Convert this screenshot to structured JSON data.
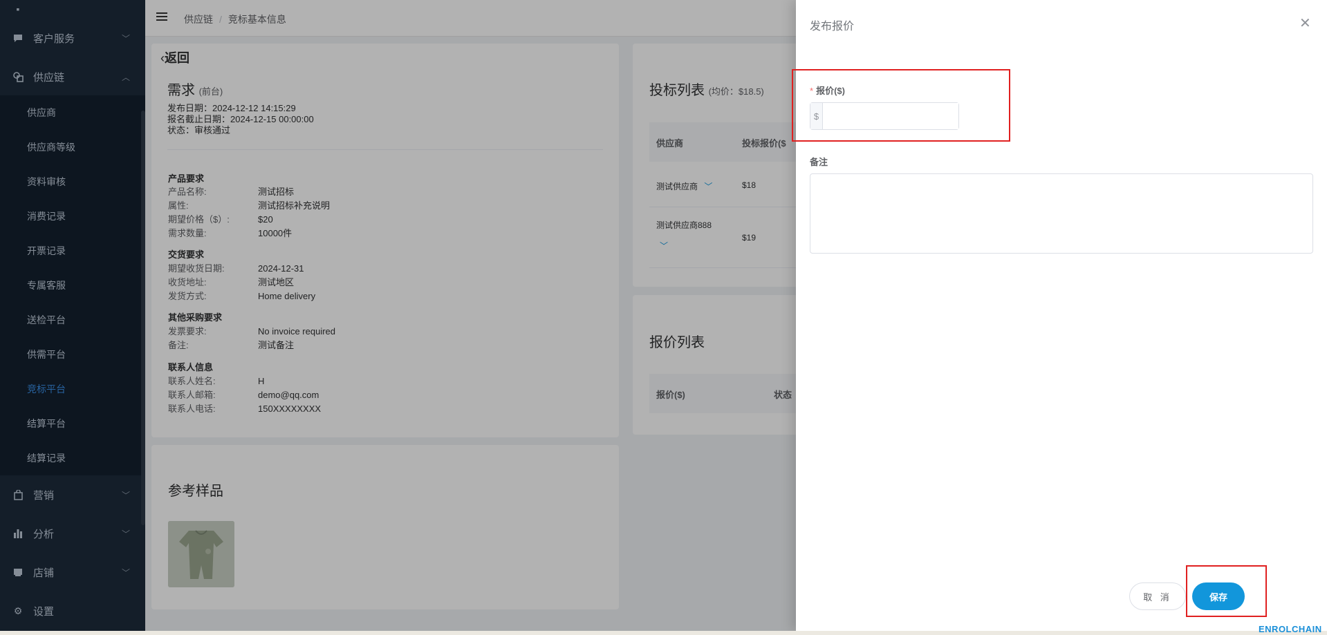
{
  "sidebar": {
    "menu": [
      {
        "label": "客户服务",
        "icon": "chat-icon"
      },
      {
        "label": "供应链",
        "icon": "supply-chain-icon"
      },
      {
        "label": "营销",
        "icon": "bag-icon"
      },
      {
        "label": "分析",
        "icon": "bar-chart-icon"
      },
      {
        "label": "店铺",
        "icon": "store-icon"
      },
      {
        "label": "设置",
        "icon": "gear-icon"
      }
    ],
    "submenu": [
      "供应商",
      "供应商等级",
      "资料审核",
      "消费记录",
      "开票记录",
      "专属客服",
      "送检平台",
      "供需平台",
      "竞标平台",
      "结算平台",
      "结算记录"
    ],
    "active_item": "竞标平台"
  },
  "header": {
    "breadcrumb": [
      "供应链",
      "竞标基本信息"
    ]
  },
  "detail": {
    "back_label": "返回",
    "title": "需求",
    "title_tag": "(前台)",
    "publish_date": "发布日期：2024-12-12 14:15:29",
    "deadline": "报名截止日期：2024-12-15 00:00:00",
    "status": "状态：审核通过",
    "sections": [
      {
        "title": "产品要求",
        "rows": [
          {
            "k": "产品名称:",
            "v": "测试招标"
          },
          {
            "k": "属性:",
            "v": "测试招标补充说明"
          },
          {
            "k": "期望价格（$）:",
            "v": "$20"
          },
          {
            "k": "需求数量:",
            "v": "10000件"
          }
        ]
      },
      {
        "title": "交货要求",
        "rows": [
          {
            "k": "期望收货日期:",
            "v": "2024-12-31"
          },
          {
            "k": "收货地址:",
            "v": "测试地区"
          },
          {
            "k": "发货方式:",
            "v": "Home delivery"
          }
        ]
      },
      {
        "title": "其他采购要求",
        "rows": [
          {
            "k": "发票要求:",
            "v": "No invoice required"
          },
          {
            "k": "备注:",
            "v": "测试备注"
          }
        ]
      },
      {
        "title": "联系人信息",
        "rows": [
          {
            "k": "联系人姓名:",
            "v": "H"
          },
          {
            "k": "联系人邮箱:",
            "v": "demo@qq.com"
          },
          {
            "k": "联系人电话:",
            "v": "150XXXXXXXX"
          }
        ]
      }
    ]
  },
  "samples": {
    "title": "参考样品"
  },
  "bids": {
    "title": "投标列表",
    "avg": "(均价：$18.5)",
    "columns": [
      "供应商",
      "投标报价($"
    ],
    "rows": [
      {
        "supplier": "测试供应商",
        "price": "$18"
      },
      {
        "supplier": "测试供应商888",
        "price": "$19"
      }
    ]
  },
  "quotes": {
    "title": "报价列表",
    "columns": [
      "报价($)",
      "状态"
    ]
  },
  "drawer": {
    "title": "发布报价",
    "price_label": "报价($)",
    "price_prefix": "$",
    "price_value": "",
    "note_label": "备注",
    "note_value": "",
    "cancel_label": "取 消",
    "save_label": "保存"
  },
  "watermark": "ENROLCHAIN",
  "colors": {
    "sidebar_bg": "#1d2b3b",
    "accent": "#1296db",
    "highlight": "#e02020",
    "active_menu": "#3a8ee6"
  }
}
